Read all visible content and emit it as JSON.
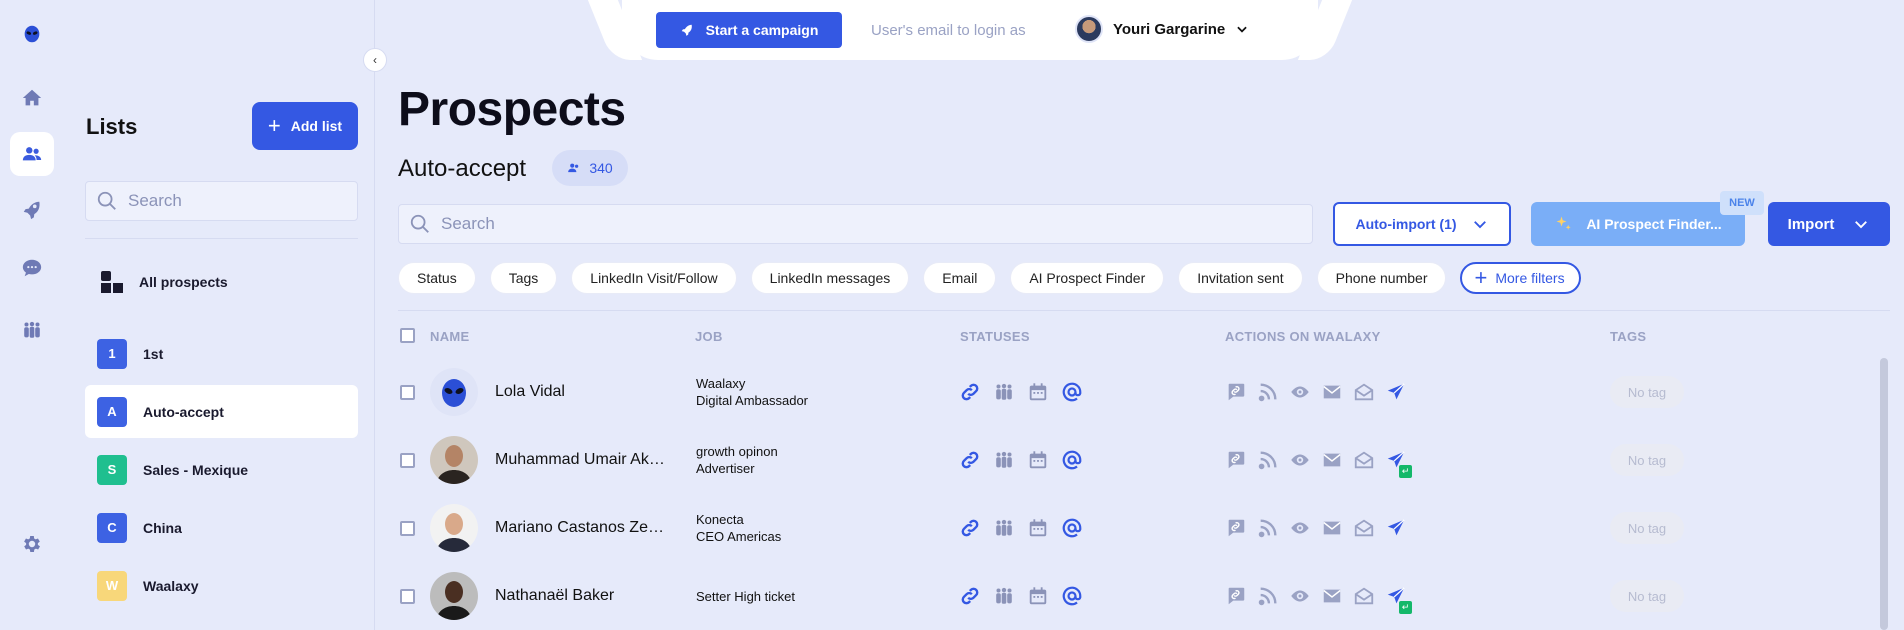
{
  "rail": {
    "items": [
      {
        "name": "logo-alien-icon"
      },
      {
        "name": "home-icon"
      },
      {
        "name": "users-icon",
        "active": true
      },
      {
        "name": "rocket-icon"
      },
      {
        "name": "chat-icon"
      },
      {
        "name": "team-icon"
      },
      {
        "name": "settings-icon"
      }
    ]
  },
  "lists": {
    "title": "Lists",
    "add_label": "Add list",
    "search_placeholder": "Search",
    "all_label": "All prospects",
    "items": [
      {
        "badge": "1",
        "label": "1st",
        "color": "#3d62e3"
      },
      {
        "badge": "A",
        "label": "Auto-accept",
        "color": "#3d62e3",
        "active": true
      },
      {
        "badge": "S",
        "label": "Sales - Mexique",
        "color": "#1fbf8f"
      },
      {
        "badge": "C",
        "label": "China",
        "color": "#3d62e3"
      },
      {
        "badge": "W",
        "label": "Waalaxy",
        "color": "#f8d77a"
      }
    ]
  },
  "topbar": {
    "campaign_label": "Start a campaign",
    "login_placeholder": "User's email to login as",
    "user_name": "Youri Gargarine"
  },
  "main": {
    "title": "Prospects",
    "list_name": "Auto-accept",
    "count": "340",
    "search_placeholder": "Search",
    "auto_import_label": "Auto-import (1)",
    "ai_label": "AI Prospect Finder...",
    "new_tag": "NEW",
    "import_label": "Import",
    "filters": [
      "Status",
      "Tags",
      "LinkedIn Visit/Follow",
      "LinkedIn messages",
      "Email",
      "AI Prospect Finder",
      "Invitation sent",
      "Phone number"
    ],
    "more_filters": "More filters",
    "columns": {
      "name": "NAME",
      "job": "JOB",
      "statuses": "STATUSES",
      "actions": "ACTIONS ON WAALAXY",
      "tags": "TAGS"
    }
  },
  "rows": [
    {
      "name": "Lola Vidal",
      "job1": "Waalaxy",
      "job2": "Digital Ambassador",
      "tag": "No tag",
      "send_badge": false
    },
    {
      "name": "Muhammad Umair Ak…",
      "job1": "growth opinon",
      "job2": "Advertiser",
      "tag": "No tag",
      "send_badge": true
    },
    {
      "name": "Mariano Castanos Ze…",
      "job1": "Konecta",
      "job2": "CEO Americas",
      "tag": "No tag",
      "send_badge": false
    },
    {
      "name": "Nathanaël Baker",
      "job1": "Setter High ticket",
      "job2": "",
      "tag": "No tag",
      "send_badge": true
    }
  ],
  "colors": {
    "accent": "#3458e3",
    "background": "#e6eafa",
    "ai_button": "#7aaef7"
  }
}
